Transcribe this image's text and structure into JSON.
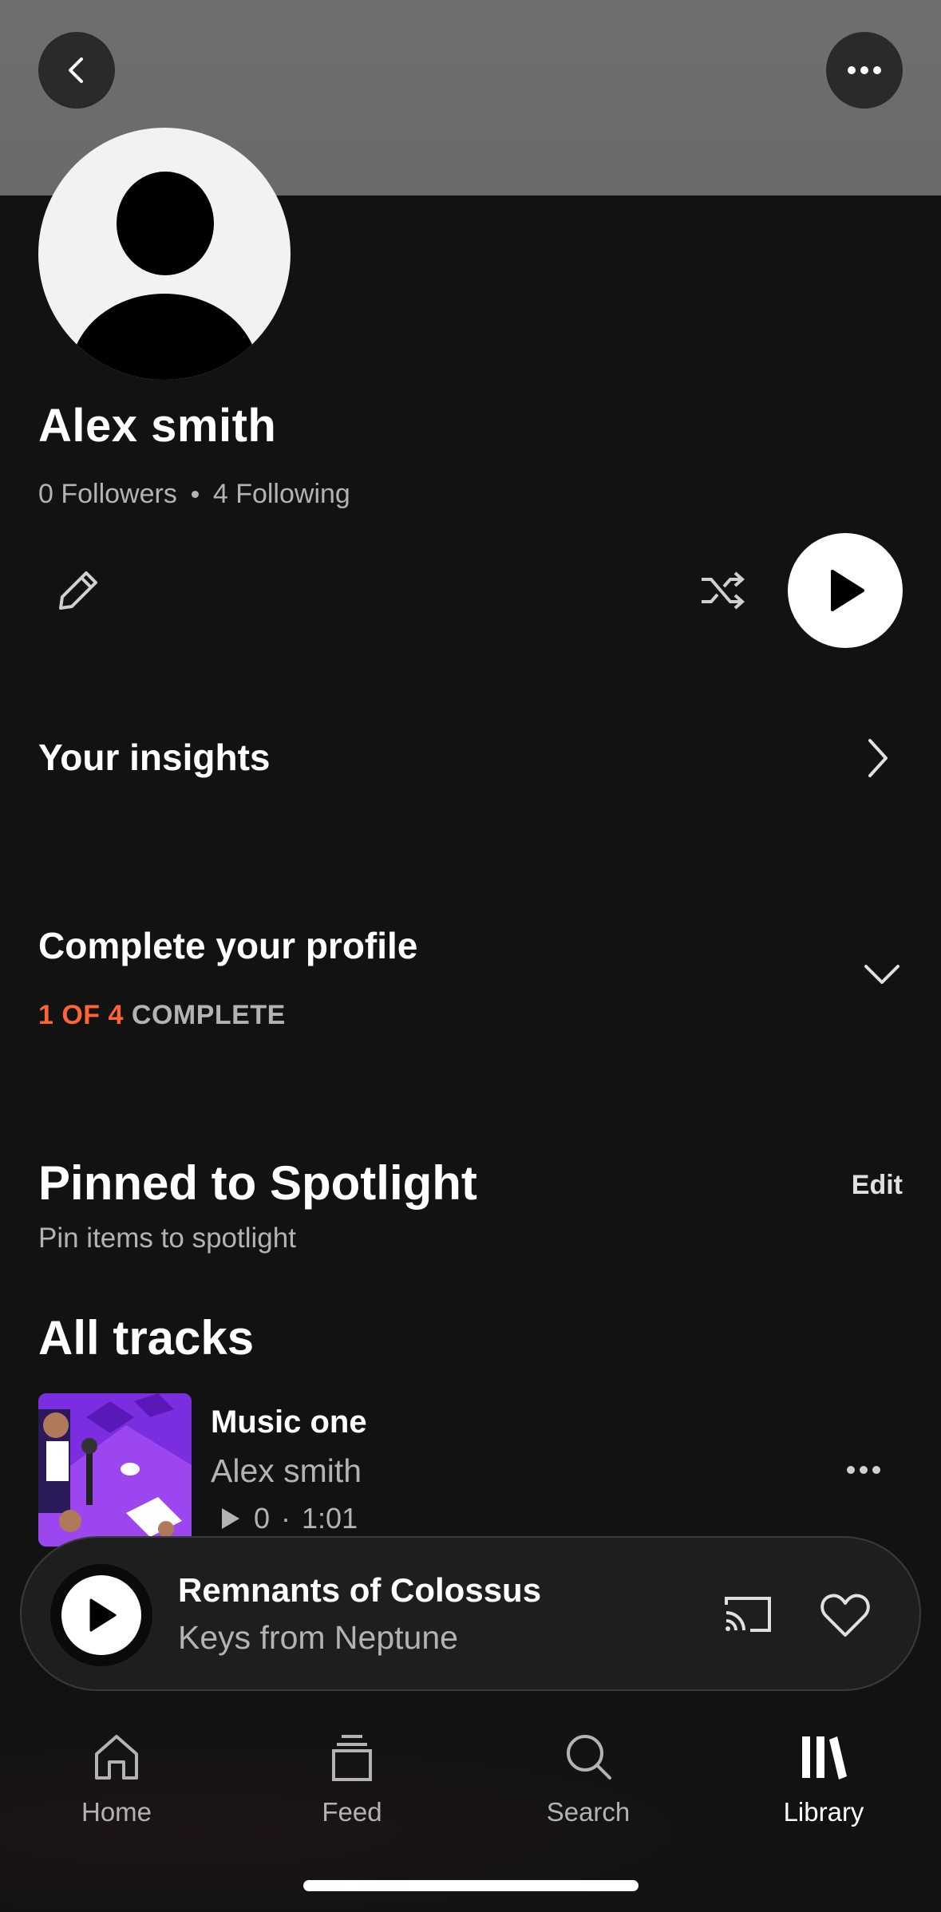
{
  "profile": {
    "name": "Alex smith",
    "followers": "0 Followers",
    "following": "4 Following"
  },
  "insights": {
    "label": "Your insights"
  },
  "complete_profile": {
    "title": "Complete your profile",
    "progress_done": "1 OF 4",
    "progress_rest": "COMPLETE",
    "progress_value": 0.25,
    "accent_color": "#ff6437"
  },
  "spotlight": {
    "title": "Pinned to Spotlight",
    "edit_label": "Edit",
    "subtitle": "Pin items to spotlight"
  },
  "tracks": {
    "title": "All tracks",
    "items": [
      {
        "title": "Music one",
        "artist": "Alex smith",
        "plays": "0",
        "duration": "1:01"
      }
    ]
  },
  "now_playing": {
    "title": "Remnants of Colossus",
    "artist": "Keys from Neptune"
  },
  "nav": {
    "items": [
      {
        "label": "Home",
        "icon": "home-icon"
      },
      {
        "label": "Feed",
        "icon": "feed-icon"
      },
      {
        "label": "Search",
        "icon": "search-icon"
      },
      {
        "label": "Library",
        "icon": "library-icon",
        "active": true
      }
    ]
  },
  "icons": {
    "back": "back-arrow-icon",
    "more": "more-options-icon",
    "edit": "pencil-icon",
    "shuffle": "shuffle-icon",
    "play": "play-icon",
    "cast": "cast-icon",
    "like": "heart-icon"
  },
  "colors": {
    "background": "#121212",
    "header": "#6f6f6f",
    "accent": "#ff6437"
  }
}
